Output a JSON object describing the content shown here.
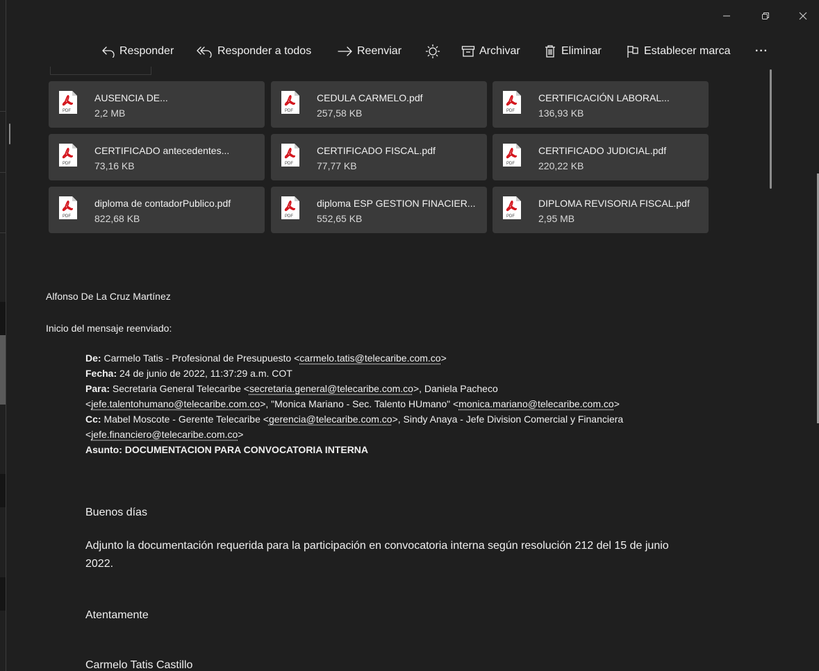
{
  "toolbar": {
    "reply": "Responder",
    "reply_all": "Responder a todos",
    "forward": "Reenviar",
    "archive": "Archivar",
    "delete": "Eliminar",
    "flag": "Establecer marca",
    "more": "···"
  },
  "attachments": [
    {
      "name": "AUSENCIA DE...",
      "size": "2,2 MB"
    },
    {
      "name": "CEDULA CARMELO.pdf",
      "size": "257,58 KB"
    },
    {
      "name": "CERTIFICACIÓN LABORAL...",
      "size": "136,93 KB"
    },
    {
      "name": "CERTIFICADO antecedentes...",
      "size": "73,16 KB"
    },
    {
      "name": "CERTIFICADO FISCAL.pdf",
      "size": "77,77 KB"
    },
    {
      "name": "CERTIFICADO JUDICIAL.pdf",
      "size": "220,22 KB"
    },
    {
      "name": "diploma de contadorPublico.pdf",
      "size": "822,68 KB"
    },
    {
      "name": "diploma ESP GESTION FINACIER...",
      "size": "552,65 KB"
    },
    {
      "name": "DIPLOMA REVISORIA FISCAL.pdf",
      "size": "2,95 MB"
    }
  ],
  "pdf_badge": "PDF",
  "message": {
    "sender_name": "Alfonso De La Cruz Martínez",
    "forward_intro": "Inicio del mensaje reenviado:",
    "from_label": "De:",
    "from_name": " Carmelo Tatis - Profesional de Presupuesto <",
    "from_email": "carmelo.tatis@telecaribe.com.co",
    "date_label": "Fecha:",
    "date_value": " 24 de junio de 2022, 11:37:29 a.m. COT",
    "to_label": "Para:",
    "to_part1": " Secretaria General Telecaribe <",
    "to_email1": "secretaria.general@telecaribe.com.co",
    "to_part2": ">, Daniela Pacheco",
    "to_email2": "jefe.talentohumano@telecaribe.com.co",
    "to_part3": ">, \"Monica Mariano - Sec. Talento HUmano\" <",
    "to_email3": "monica.mariano@telecaribe.com.co",
    "cc_label": "Cc:",
    "cc_part1": " Mabel Moscote - Gerente Telecaribe <",
    "cc_email1": "gerencia@telecaribe.com.co",
    "cc_part2": ">, Sindy Anaya - Jefe Division Comercial y Financiera",
    "cc_email2": "jefe.financiero@telecaribe.com.co",
    "subject": "Asunto: DOCUMENTACION PARA CONVOCATORIA INTERNA",
    "greeting": "Buenos días",
    "body_line1": "Adjunto la documentación requerida para la participación en convocatoria interna según resolución 212 del 15 de junio",
    "body_line2": "2022.",
    "closing": "Atentamente",
    "signature": "Carmelo Tatis Castillo"
  }
}
